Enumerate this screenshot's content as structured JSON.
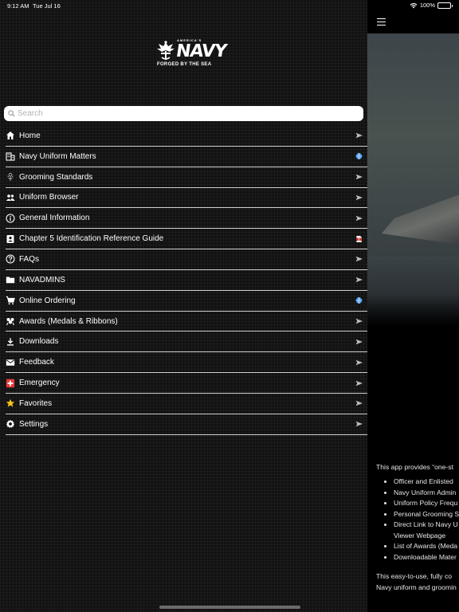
{
  "status_bar": {
    "time": "9:12 AM",
    "date": "Tue Jul 16",
    "battery": "100%",
    "battery_level": 1.0
  },
  "logo": {
    "tagline_top": "AMERICA'S",
    "wordmark": "NAVY",
    "tagline_bottom": "FORGED BY THE SEA"
  },
  "search": {
    "placeholder": "Search",
    "value": ""
  },
  "menu": {
    "items": [
      {
        "label": "Home",
        "icon": "home-icon",
        "trailing": "arrow-icon"
      },
      {
        "label": "Navy Uniform Matters",
        "icon": "building-icon",
        "trailing": "globe-icon"
      },
      {
        "label": "Grooming Standards",
        "icon": "grooming-icon",
        "trailing": "arrow-icon"
      },
      {
        "label": "Uniform Browser",
        "icon": "people-icon",
        "trailing": "arrow-icon"
      },
      {
        "label": "General Information",
        "icon": "info-icon",
        "trailing": "arrow-icon"
      },
      {
        "label": "Chapter 5 Identification Reference Guide",
        "icon": "id-badge-icon",
        "trailing": "pdf-icon"
      },
      {
        "label": "FAQs",
        "icon": "help-icon",
        "trailing": "arrow-icon"
      },
      {
        "label": "NAVADMINS",
        "icon": "folder-icon",
        "trailing": "arrow-icon"
      },
      {
        "label": "Online Ordering",
        "icon": "cart-icon",
        "trailing": "globe-icon"
      },
      {
        "label": "Awards (Medals & Ribbons)",
        "icon": "medal-icon",
        "trailing": "arrow-icon"
      },
      {
        "label": "Downloads",
        "icon": "download-icon",
        "trailing": "arrow-icon"
      },
      {
        "label": "Feedback",
        "icon": "mail-icon",
        "trailing": "arrow-icon"
      },
      {
        "label": "Emergency",
        "icon": "emergency-icon",
        "trailing": "arrow-icon"
      },
      {
        "label": "Favorites",
        "icon": "star-icon",
        "trailing": "arrow-icon"
      },
      {
        "label": "Settings",
        "icon": "gear-icon",
        "trailing": "arrow-icon"
      }
    ]
  },
  "content": {
    "intro": "This app provides “one-st",
    "bullets": [
      "Officer and Enlisted",
      "Navy Uniform Admin",
      "Uniform Policy Frequ",
      "Personal Grooming S",
      "Direct Link to Navy U",
      "Viewer Webpage",
      "List of Awards (Meda",
      "Downloadable Mater"
    ],
    "outro_line1": "This easy-to-use, fully co",
    "outro_line2": "Navy uniform and groomin"
  },
  "colors": {
    "globe": "#3a8ee6",
    "pdf": "#d32f2f",
    "emergency": "#e53935",
    "favorite": "#f5c518",
    "divider": "#cfcfcf"
  }
}
